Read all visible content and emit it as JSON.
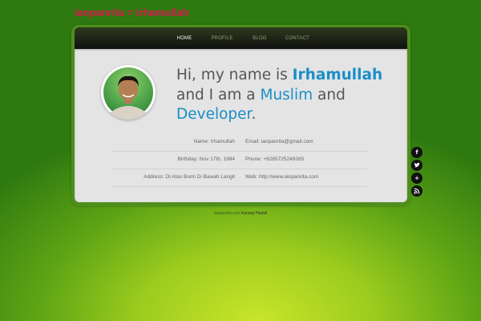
{
  "site_title": "Ianpanrita = Irhamullah",
  "nav": {
    "home": "HOME",
    "profile": "PROFILE",
    "blog": "BLOG",
    "contact": "CONTACT"
  },
  "intro": {
    "part1": "Hi, my name is ",
    "name": "Irhamullah",
    "part2": "and I am a ",
    "religion": "Muslim",
    "part3": " and",
    "role": "Developer",
    "part4": "."
  },
  "info": [
    {
      "left": "Name: Irhamullah",
      "right": "Email: ianpanrita@gmail.com"
    },
    {
      "left": "Birthday: Nov 17th, 1984",
      "right": "Phone: +6285725249265"
    },
    {
      "left": "Address: Di Atas Bumi Di Bawah Langit",
      "right": "Web: http://www.ianpanrita.com"
    }
  ],
  "social": {
    "facebook": "f",
    "twitter": "t",
    "googleplus": "+",
    "rss": "rss"
  },
  "footer": {
    "link": "ianpanrita.com",
    "text": " Karung Plastik"
  },
  "colors": {
    "title": "#d8174d",
    "accent": "#1a8ec8"
  }
}
